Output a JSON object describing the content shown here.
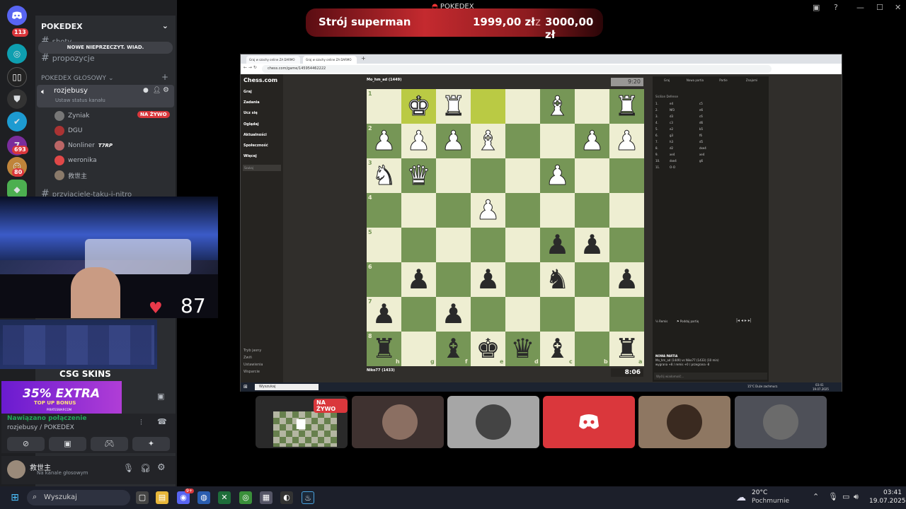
{
  "window": {
    "title": "POKEDEX",
    "colors": {
      "discord_bg": "#1e1f22",
      "panel": "#2b2d31",
      "chess_light": "#eeeed2",
      "chess_dark": "#769656",
      "live_red": "#da373c"
    }
  },
  "server_rail": {
    "badges": [
      "113",
      "693",
      "80"
    ]
  },
  "channels": {
    "guild_name": "POKEDEX",
    "items": [
      "shoty",
      "propozycje"
    ],
    "tooltip": "NOWE NIEPRZECZYT. WIAD.",
    "voice_category": "POKEDEX GŁOSOWY",
    "voice_channel": "rozjebusy",
    "voice_status": "Ustaw status kanału",
    "users": [
      {
        "name": "Zyniak",
        "live": "NA ŻYWO"
      },
      {
        "name": "DGU"
      },
      {
        "name": "Nonliner",
        "tag": "T7RP"
      },
      {
        "name": "weronika"
      },
      {
        "name": "救世主"
      }
    ],
    "next_channel": "przyjaciele-taku-i-nitro"
  },
  "donation": {
    "label": "Strój superman",
    "current": "1999,00 zł",
    "sep": "z",
    "goal": "3000,00 zł"
  },
  "browser": {
    "tabs": [
      "Graj w szachy online ZA DARMO",
      "Graj w szachy online ZA DARMO"
    ],
    "url": "chess.com/game/145954462222"
  },
  "chess": {
    "logo": "Chess.com",
    "nav": [
      "Graj",
      "Zadania",
      "Ucz się",
      "Oglądaj",
      "Aktualności",
      "Społeczność",
      "Więcej"
    ],
    "search_placeholder": "Szukaj",
    "bottom_nav": [
      "Tryb jasny",
      "Zwiń",
      "Ustawienia",
      "Wsparcie"
    ],
    "player_top": "Mo_hm_ad (1449)",
    "player_bottom": "Niko77 (1433)",
    "clock_top": "9:20",
    "clock_bottom": "8:06",
    "ranks": [
      "1",
      "2",
      "3",
      "4",
      "5",
      "6",
      "7",
      "8"
    ],
    "files": [
      "h",
      "g",
      "f",
      "e",
      "d",
      "c",
      "b",
      "a"
    ],
    "panel_tabs": [
      "Graj",
      "Nowa partia",
      "Partie",
      "Znajomi"
    ],
    "opening": "Sicilian Defense",
    "moves": [
      [
        "1.",
        "e4",
        "c5"
      ],
      [
        "2.",
        "Nf3",
        "e6"
      ],
      [
        "3.",
        "d3",
        "c6"
      ],
      [
        "4.",
        "c3",
        "d6"
      ],
      [
        "5.",
        "e2",
        "b5"
      ],
      [
        "6.",
        "g3",
        "f6"
      ],
      [
        "7.",
        "h3",
        "d5"
      ],
      [
        "8.",
        "d2",
        "dxe4"
      ],
      [
        "9.",
        "xe4",
        "xe4"
      ],
      [
        "10.",
        "dxe4",
        "g6"
      ],
      [
        "11.",
        "O-O",
        ""
      ]
    ],
    "panel_actions": [
      "Remis",
      "Poddaj partię"
    ],
    "new_game_title": "NOWA PARTIA",
    "new_game_line1": "Mo_hm_ad (1449) vs Niko77 (1433) (10 min)",
    "new_game_line2": "wygrana +8 / remis +0 / przegrana -8",
    "message_placeholder": "Wyślij wiadomość..."
  },
  "inner_taskbar": {
    "search": "Wyszukaj",
    "weather": "15°C  Duże zachmurz.",
    "time": "03:41",
    "date": "19.07.2025"
  },
  "webcam": {
    "heart_rate": "87"
  },
  "ad": {
    "csg": "CSG SKINS",
    "bonus_big": "35% EXTRA",
    "bonus_small": "TOP UP BONUS",
    "site": "PIRATESWAP.COM"
  },
  "voice_panel": {
    "status": "Nawiązano połączenie",
    "channel": "rozjebusy / POKEDEX"
  },
  "user_panel": {
    "name": "救世主",
    "status": "Na kanale głosowym"
  },
  "tiles": {
    "live_badge": "NA ŻYWO"
  },
  "taskbar": {
    "search": "Wyszukaj",
    "discord_badge": "9+",
    "temp": "20°C",
    "weather": "Pochmurnie",
    "time": "03:41",
    "date": "19.07.2025"
  }
}
